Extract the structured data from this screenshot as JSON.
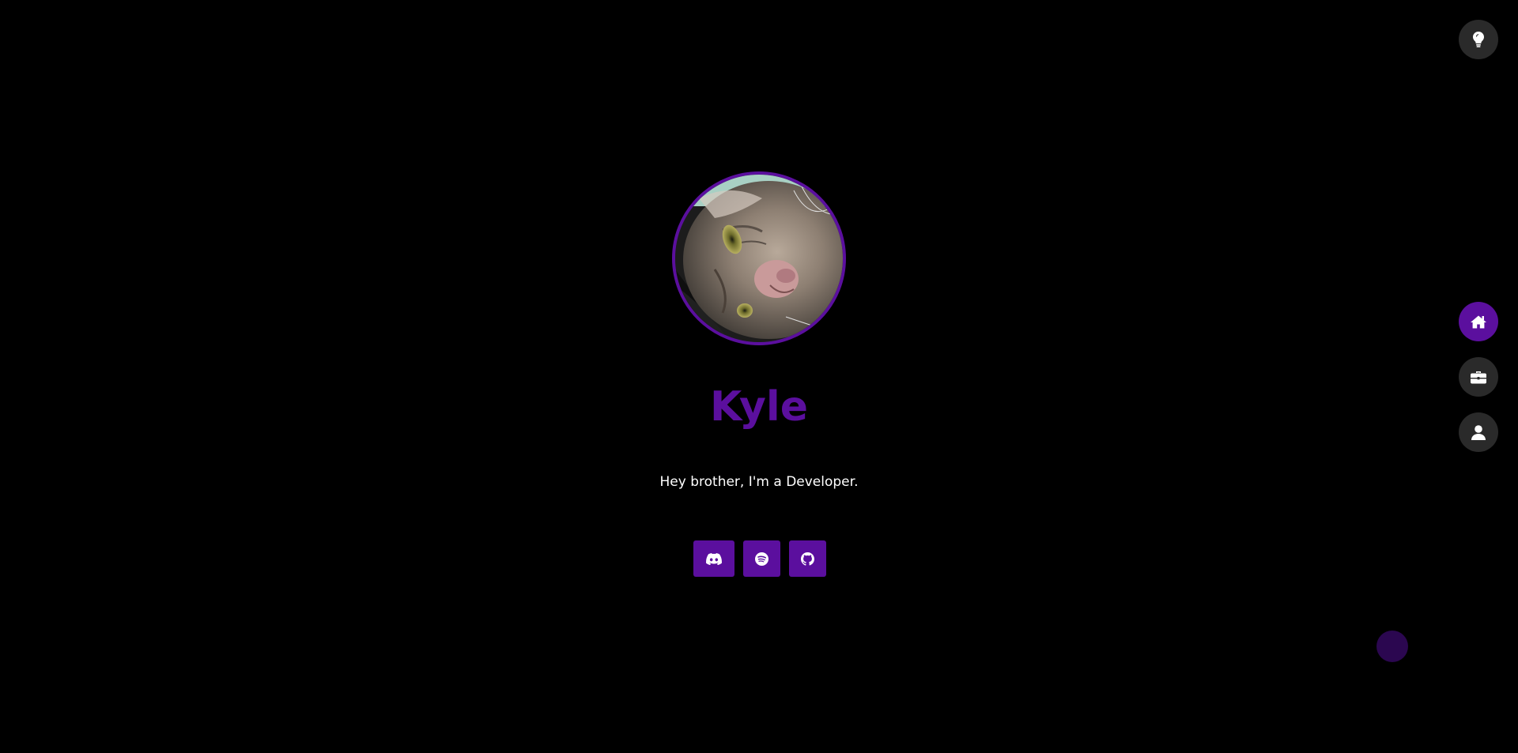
{
  "profile": {
    "name": "Kyle",
    "tagline": "Hey brother, I'm a Developer.",
    "avatar_icon": "cat-photo"
  },
  "socials": [
    {
      "icon": "discord-icon"
    },
    {
      "icon": "spotify-icon"
    },
    {
      "icon": "github-icon"
    }
  ],
  "nav": {
    "items": [
      {
        "icon": "home-icon",
        "active": true
      },
      {
        "icon": "briefcase-icon",
        "active": false
      },
      {
        "icon": "user-icon",
        "active": false
      }
    ]
  },
  "theme_toggle": {
    "icon": "lightbulb-icon"
  },
  "colors": {
    "accent": "#5b0f9e",
    "background": "#000000",
    "button_bg": "#2a2a2a",
    "text": "#ffffff"
  }
}
